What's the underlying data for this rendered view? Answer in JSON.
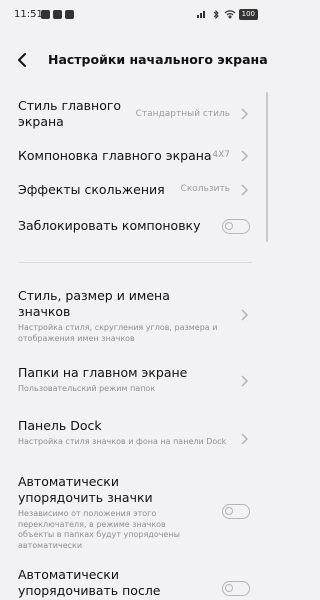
{
  "status_bar": {
    "time": "11:51",
    "battery": "100"
  },
  "header": {
    "title": "Настройки начального экрана"
  },
  "settings": {
    "home_style": {
      "title": "Стиль главного экрана",
      "value": "Стандартный стиль"
    },
    "layout": {
      "title": "Компоновка главного экрана",
      "value": "4X7"
    },
    "scroll_effects": {
      "title": "Эффекты скольжения",
      "value": "Скользить"
    },
    "lock_layout": {
      "title": "Заблокировать компоновку",
      "enabled": false
    },
    "icon_style": {
      "title": "Стиль, размер и имена значков",
      "subtitle": "Настройка стиля, скругления углов, размера и отображения имен значков"
    },
    "folders": {
      "title": "Папки на главном экране",
      "subtitle": "Пользовательский режим папок"
    },
    "dock": {
      "title": "Панель Dock",
      "subtitle": "Настройка стиля значков и фона на панели Dock"
    },
    "auto_arrange": {
      "title": "Автоматически упорядочить значки",
      "subtitle": "Независимо от положения этого переключателя, в режиме значков объекты в папках будут упорядочены автоматически",
      "enabled": false
    },
    "auto_arrange_after": {
      "title": "Автоматически упорядочивать после",
      "enabled": false
    }
  },
  "colors": {
    "background": "#f2f2f4",
    "secondary_text": "#8e8e93",
    "toggle_off": "#b5b5b5"
  }
}
